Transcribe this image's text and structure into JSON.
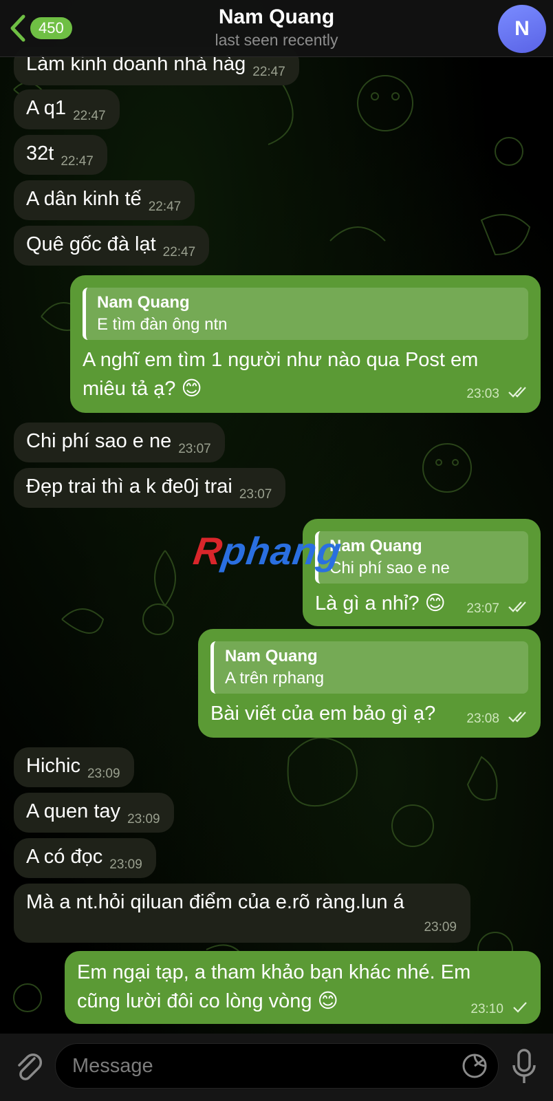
{
  "header": {
    "back_count": "450",
    "title": "Nam Quang",
    "status": "last seen recently",
    "avatar_letter": "N"
  },
  "watermark": {
    "first": "R",
    "rest": "phang"
  },
  "messages": [
    {
      "dir": "in",
      "text": "Làm kinh doanh nhà hàg",
      "time": "22:47"
    },
    {
      "dir": "in",
      "text": "A q1",
      "time": "22:47"
    },
    {
      "dir": "in",
      "text": "32t",
      "time": "22:47"
    },
    {
      "dir": "in",
      "text": "A dân kinh tế",
      "time": "22:47"
    },
    {
      "dir": "in",
      "text": "Quê gốc đà lạt",
      "time": "22:47"
    },
    {
      "dir": "out",
      "reply_name": "Nam Quang",
      "reply_text": "E tìm đàn ông ntn",
      "line1": "A nghĩ em tìm 1 người như nào qua Post em",
      "line2": "miêu tả ạ? 😊",
      "time": "23:03"
    },
    {
      "dir": "in",
      "text": "Chi phí sao e ne",
      "time": "23:07"
    },
    {
      "dir": "in",
      "text": "Đẹp trai thì a k đe0j trai",
      "time": "23:07"
    },
    {
      "dir": "out",
      "reply_name": "Nam Quang",
      "reply_text": "Chi phí sao e ne",
      "text": "Là gì a nhỉ? 😊",
      "time": "23:07"
    },
    {
      "dir": "out",
      "reply_name": "Nam Quang",
      "reply_text": "A trên rphang",
      "text": "Bài viết của em bảo gì ạ?",
      "time": "23:08"
    },
    {
      "dir": "in",
      "text": "Hichic",
      "time": "23:09"
    },
    {
      "dir": "in",
      "text": "A quen tay",
      "time": "23:09"
    },
    {
      "dir": "in",
      "text": "A có đọc",
      "time": "23:09"
    },
    {
      "dir": "in",
      "text": "Mà a nt.hỏi qiluan điểm của e.rõ ràng.lun á",
      "time": "23:09"
    },
    {
      "dir": "out",
      "line1": "Em ngại tạp, a tham khảo bạn khác nhé. Em",
      "line2": "cũng lười đôi co lòng vòng 😊",
      "time": "23:10"
    }
  ],
  "input": {
    "placeholder": "Message"
  },
  "icons": [
    "chevron-left-icon",
    "attach-icon",
    "sticker-icon",
    "mic-icon",
    "double-check-icon",
    "single-check-icon"
  ],
  "colors": {
    "outgoing": "#5b9a35",
    "incoming": "#1f2219",
    "badge": "#6fbf44",
    "avatar": "#6b77f2"
  }
}
